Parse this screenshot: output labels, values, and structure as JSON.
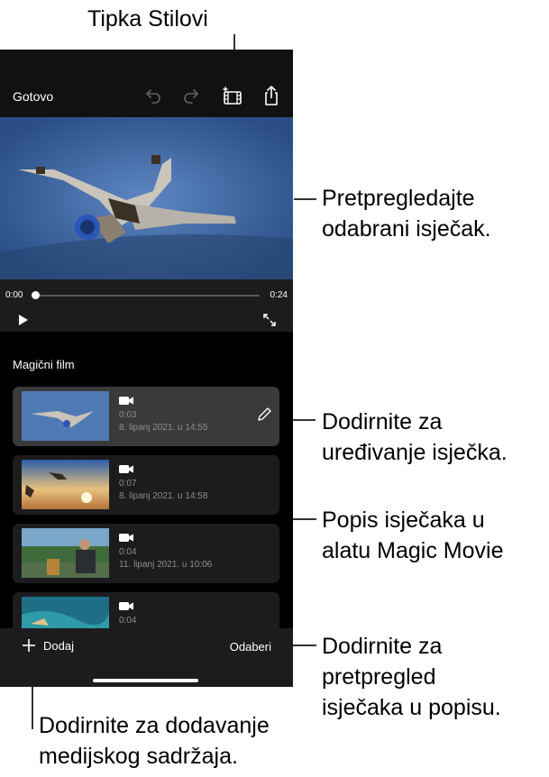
{
  "callouts": {
    "styles_button": "Tipka Stilovi",
    "preview_line1": "Pretpregledajte",
    "preview_line2": "odabrani isječak.",
    "edit_line1": "Dodirnite za",
    "edit_line2": "uređivanje isječka.",
    "list_line1": "Popis isječaka u",
    "list_line2": "alatu Magic Movie",
    "select_line1": "Dodirnite za",
    "select_line2": "pretpregled",
    "select_line3": "isječaka u popisu.",
    "add_line1": "Dodirnite za dodavanje",
    "add_line2": "medijskog sadržaja."
  },
  "toolbar": {
    "done_label": "Gotovo",
    "icons": [
      "undo-icon",
      "redo-icon",
      "styles-icon",
      "share-icon"
    ]
  },
  "player": {
    "current_time": "0:00",
    "total_time": "0:24",
    "progress": 0.0
  },
  "list": {
    "title": "Magični film",
    "clips": [
      {
        "duration": "0:03",
        "date": "8. lipanj 2021. u 14:55",
        "selected": true
      },
      {
        "duration": "0:07",
        "date": "8. lipanj 2021. u 14:58",
        "selected": false
      },
      {
        "duration": "0:04",
        "date": "11. lipanj 2021. u 10:06",
        "selected": false
      },
      {
        "duration": "0:04",
        "date": "",
        "selected": false
      }
    ]
  },
  "bottom": {
    "add_label": "Dodaj",
    "select_label": "Odaberi"
  },
  "colors": {
    "background": "#000000",
    "bar": "#1c1c1e",
    "selected_row": "#3a3a3c",
    "secondary_text": "#8e8e93"
  }
}
